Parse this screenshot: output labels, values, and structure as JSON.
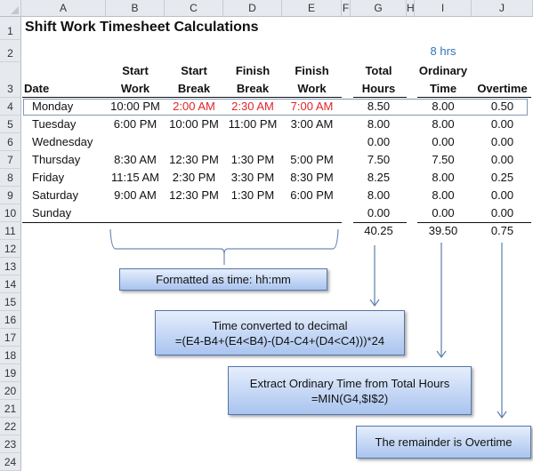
{
  "columns": [
    "A",
    "B",
    "C",
    "D",
    "E",
    "F",
    "G",
    "H",
    "I",
    "J"
  ],
  "rows": [
    "1",
    "2",
    "3",
    "4",
    "5",
    "6",
    "7",
    "8",
    "9",
    "10",
    "11",
    "12",
    "13",
    "14",
    "15",
    "16",
    "17",
    "18",
    "19",
    "20",
    "21",
    "22",
    "23",
    "24"
  ],
  "title": "Shift Work Timesheet Calculations",
  "ordinary_hours_setting": "8 hrs",
  "headers": {
    "date": "Date",
    "start_work": [
      "Start",
      "Work"
    ],
    "start_break": [
      "Start",
      "Break"
    ],
    "finish_break": [
      "Finish",
      "Break"
    ],
    "finish_work": [
      "Finish",
      "Work"
    ],
    "total_hours": [
      "Total",
      "Hours"
    ],
    "ordinary_time": [
      "Ordinary",
      "Time"
    ],
    "overtime": "Overtime"
  },
  "table": [
    {
      "day": "Monday",
      "start_work": "10:00 PM",
      "start_break": "2:00 AM",
      "finish_break": "2:30 AM",
      "finish_work": "7:00 AM",
      "total": "8.50",
      "ordinary": "8.00",
      "overtime": "0.50"
    },
    {
      "day": "Tuesday",
      "start_work": "6:00 PM",
      "start_break": "10:00 PM",
      "finish_break": "11:00 PM",
      "finish_work": "3:00 AM",
      "total": "8.00",
      "ordinary": "8.00",
      "overtime": "0.00"
    },
    {
      "day": "Wednesday",
      "start_work": "",
      "start_break": "",
      "finish_break": "",
      "finish_work": "",
      "total": "0.00",
      "ordinary": "0.00",
      "overtime": "0.00"
    },
    {
      "day": "Thursday",
      "start_work": "8:30 AM",
      "start_break": "12:30 PM",
      "finish_break": "1:30 PM",
      "finish_work": "5:00 PM",
      "total": "7.50",
      "ordinary": "7.50",
      "overtime": "0.00"
    },
    {
      "day": "Friday",
      "start_work": "11:15 AM",
      "start_break": "2:30 PM",
      "finish_break": "3:30 PM",
      "finish_work": "8:30 PM",
      "total": "8.25",
      "ordinary": "8.00",
      "overtime": "0.25"
    },
    {
      "day": "Saturday",
      "start_work": "9:00 AM",
      "start_break": "12:30 PM",
      "finish_break": "1:30 PM",
      "finish_work": "6:00 PM",
      "total": "8.00",
      "ordinary": "8.00",
      "overtime": "0.00"
    },
    {
      "day": "Sunday",
      "start_work": "",
      "start_break": "",
      "finish_break": "",
      "finish_work": "",
      "total": "0.00",
      "ordinary": "0.00",
      "overtime": "0.00"
    }
  ],
  "totals": {
    "total": "40.25",
    "ordinary": "39.50",
    "overtime": "0.75"
  },
  "highlight_color": "#e0242b",
  "callouts": {
    "format": "Formatted as time: hh:mm",
    "decimal": [
      "Time converted to decimal",
      "=(E4-B4+(E4<B4)-(D4-C4+(D4<C4)))*24"
    ],
    "ordinary": [
      "Extract Ordinary Time from Total Hours",
      "=MIN(G4,$I$2)"
    ],
    "overtime": "The remainder is Overtime"
  }
}
